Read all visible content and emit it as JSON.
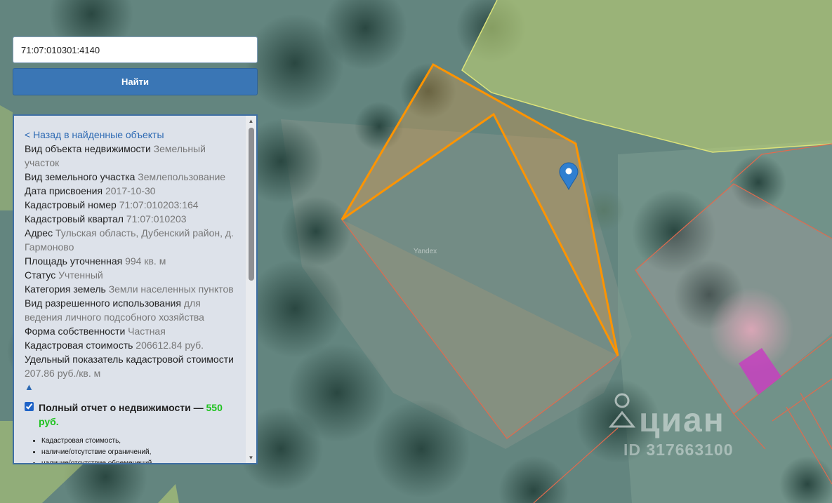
{
  "search": {
    "value": "71:07:010301:4140"
  },
  "find_button": {
    "label": "Найти"
  },
  "panel": {
    "back_link": "< Назад в найденные объекты",
    "fields": [
      {
        "label": "Вид объекта недвижимости",
        "value": "Земельный участок"
      },
      {
        "label": "Вид земельного участка",
        "value": "Землепользование"
      },
      {
        "label": "Дата присвоения",
        "value": "2017-10-30"
      },
      {
        "label": "Кадастровый номер",
        "value": "71:07:010203:164"
      },
      {
        "label": "Кадастровый квартал",
        "value": "71:07:010203"
      },
      {
        "label": "Адрес",
        "value": "Тульская область, Дубенский район, д. Гармоново"
      },
      {
        "label": "Площадь уточненная",
        "value": "994 кв. м"
      },
      {
        "label": "Статус",
        "value": "Учтенный"
      },
      {
        "label": "Категория земель",
        "value": "Земли населенных пунктов"
      },
      {
        "label": "Вид разрешенного использования",
        "value": "для ведения личного подсобного хозяйства"
      },
      {
        "label": "Форма собственности",
        "value": "Частная"
      },
      {
        "label": "Кадастровая стоимость",
        "value": "206612.84 руб."
      },
      {
        "label": "Удельный показатель кадастровой стоимости",
        "value": "207.86 руб./кв. м"
      }
    ],
    "collapse_arrow": "▲",
    "report": {
      "label": "Полный отчет о недвижимости —",
      "price": "550 руб.",
      "checked": true,
      "items": [
        "Кадастровая стоимость,",
        "наличие/отсутствие ограничений,",
        "наличие/отсутствие обременений,"
      ]
    }
  },
  "map": {
    "attribution": "Yandex",
    "watermark_brand": "циан",
    "watermark_id": "ID 317663100",
    "highlight_color": "#ff9400"
  }
}
